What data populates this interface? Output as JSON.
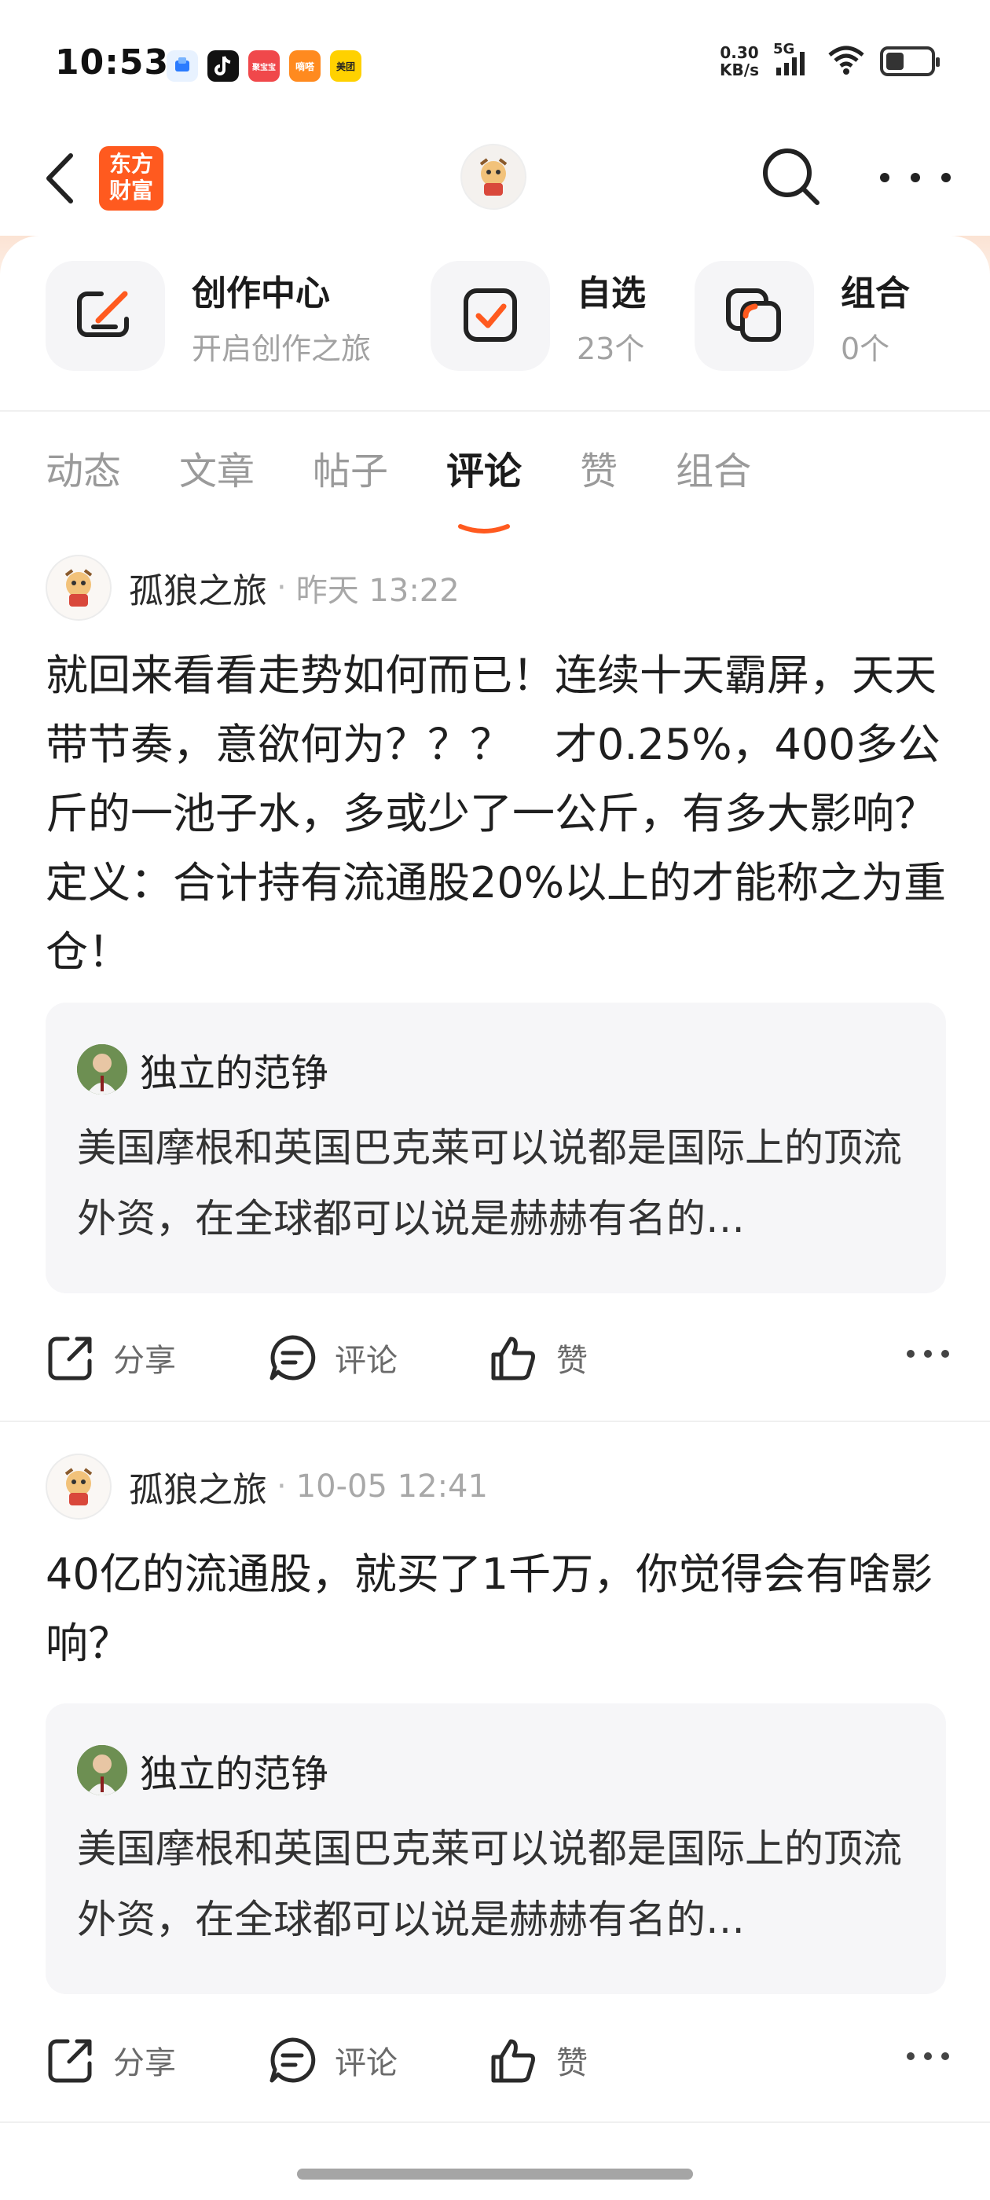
{
  "status_bar": {
    "time": "10:53",
    "net_speed_value": "0.30",
    "net_speed_unit": "KB/s",
    "network": "5G",
    "notif_labels": [
      "聚宝宝",
      "嘀嗒",
      "美团"
    ]
  },
  "nav": {
    "logo_line1": "东方",
    "logo_line2": "财富"
  },
  "quick_entries": [
    {
      "title": "创作中心",
      "subtitle": "开启创作之旅"
    },
    {
      "title": "自选",
      "subtitle": "23个"
    },
    {
      "title": "组合",
      "subtitle": "0个"
    }
  ],
  "tabs": [
    "动态",
    "文章",
    "帖子",
    "评论",
    "赞",
    "组合"
  ],
  "active_tab": "评论",
  "posts": [
    {
      "author": "孤狼之旅",
      "time": "昨天 13:22",
      "content": "就回来看看走势如何而已！连续十天霸屏，天天带节奏，意欲何为？？？　才0.25%，400多公斤的一池子水，多或少了一公斤，有多大影响？　定义：合计持有流通股20%以上的才能称之为重仓！",
      "quote": {
        "author": "独立的范铮",
        "text": "美国摩根和英国巴克莱可以说都是国际上的顶流外资，在全球都可以说是赫赫有名的…"
      },
      "actions": {
        "share": "分享",
        "comment": "评论",
        "like": "赞"
      }
    },
    {
      "author": "孤狼之旅",
      "time": "10-05 12:41",
      "content": "40亿的流通股，就买了1千万，你觉得会有啥影响？",
      "quote": {
        "author": "独立的范铮",
        "text": "美国摩根和英国巴克莱可以说都是国际上的顶流外资，在全球都可以说是赫赫有名的…"
      },
      "actions": {
        "share": "分享",
        "comment": "评论",
        "like": "赞"
      }
    }
  ],
  "colors": {
    "accent": "#ff5a1f",
    "header_tint": "#fbe3d4",
    "muted_text": "#a2a2a2"
  },
  "icons": {
    "nav": [
      "back-arrow-icon",
      "search-icon",
      "more-icon"
    ],
    "quick": [
      "edit-icon",
      "checkbox-icon",
      "portfolio-icon"
    ],
    "actions": [
      "share-icon",
      "comment-icon",
      "thumbs-up-icon",
      "more-icon"
    ]
  }
}
